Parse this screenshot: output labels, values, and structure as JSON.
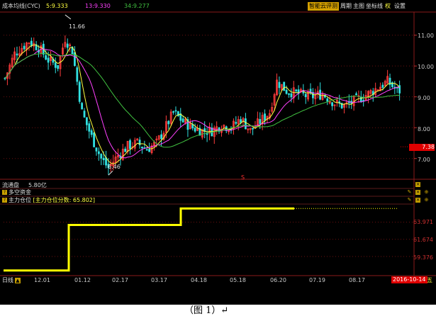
{
  "header": {
    "indicator_name": "成本均线(CYC)",
    "ma5": "5:9.333",
    "ma13": "13:9.330",
    "ma34": "34:9.277"
  },
  "toolbar": {
    "cloud_label": "智能云评测",
    "period_label": "周期",
    "main_chart_label": "主图",
    "axis_label": "坐标线",
    "rights_label": "权",
    "settings_label": "设置"
  },
  "price_axis": {
    "ticks": [
      "11.00",
      "10.00",
      "9.00",
      "8.00",
      "7.00"
    ],
    "current_price": "7.38"
  },
  "annotations": {
    "high_label": "11.66",
    "low_label": "6.46",
    "s_marker": "S"
  },
  "float_share": {
    "label": "流通盘",
    "value": "5.80亿"
  },
  "panels": {
    "dkzj_label": "多空资金",
    "zlcw_label": "主力仓位",
    "zlcw_score": "[主力仓位分数: 65.802]"
  },
  "sub_axis": {
    "ticks": [
      "63.971",
      "61.674",
      "59.376"
    ]
  },
  "time_axis": {
    "period": "日线",
    "dates": [
      "12.01",
      "01.12",
      "02.17",
      "03.17",
      "04.18",
      "05.18",
      "06.20",
      "07.19",
      "08.17"
    ],
    "current_date": "2016-10-14",
    "weekday": "五"
  },
  "caption": "（图 1）↵",
  "colors": {
    "bg": "#000000",
    "up": "#ff3c3c",
    "down": "#30e0e0",
    "ma5": "#ffff40",
    "ma13": "#ff40ff",
    "ma34": "#40c040",
    "step": "#ffff00",
    "grid": "#6a1010",
    "cloud_bg": "#d4a000"
  },
  "chart_data": [
    {
      "type": "candlestick",
      "title": "成本均线(CYC)",
      "price_ticks": [
        11.0,
        10.0,
        9.0,
        8.0,
        7.0
      ],
      "ylim": [
        6.35,
        11.75
      ],
      "x_ticks": [
        "12.01",
        "01.12",
        "02.17",
        "03.17",
        "04.18",
        "05.18",
        "06.20",
        "07.19",
        "08.17"
      ],
      "anchor_prices": [
        [
          0,
          9.6
        ],
        [
          4,
          10.4
        ],
        [
          10,
          10.8
        ],
        [
          14,
          10.6
        ],
        [
          18,
          10.2
        ],
        [
          22,
          10.0
        ],
        [
          25,
          10.9
        ],
        [
          28,
          10.5
        ],
        [
          32,
          8.5
        ],
        [
          36,
          7.7
        ],
        [
          40,
          7.0
        ],
        [
          43,
          6.7
        ],
        [
          47,
          7.1
        ],
        [
          51,
          7.4
        ],
        [
          55,
          7.5
        ],
        [
          59,
          7.3
        ],
        [
          63,
          7.5
        ],
        [
          66,
          7.9
        ],
        [
          70,
          8.5
        ],
        [
          74,
          8.2
        ],
        [
          78,
          8.0
        ],
        [
          82,
          7.9
        ],
        [
          86,
          7.9
        ],
        [
          90,
          8.1
        ],
        [
          94,
          8.0
        ],
        [
          98,
          8.3
        ],
        [
          102,
          7.9
        ],
        [
          106,
          8.2
        ],
        [
          110,
          8.5
        ],
        [
          113,
          9.5
        ],
        [
          117,
          9.2
        ],
        [
          122,
          9.1
        ],
        [
          127,
          9.0
        ],
        [
          132,
          9.1
        ],
        [
          137,
          8.8
        ],
        [
          141,
          8.7
        ],
        [
          146,
          8.9
        ],
        [
          151,
          9.1
        ],
        [
          155,
          9.3
        ],
        [
          159,
          9.5
        ],
        [
          163,
          9.2
        ]
      ],
      "high_mark": 11.66,
      "low_mark": 6.46,
      "last_price": 7.38,
      "series": [
        {
          "name": "5",
          "value": 9.333
        },
        {
          "name": "13",
          "value": 9.33
        },
        {
          "name": "34",
          "value": 9.277
        }
      ]
    },
    {
      "type": "line",
      "title": "主力仓位",
      "y_ticks": [
        63.971,
        61.674,
        59.376
      ],
      "ylim": [
        57.0,
        66.3
      ],
      "steps": [
        {
          "from": "12.01",
          "value": 57.5
        },
        {
          "from": "01.12",
          "value": 63.6
        },
        {
          "from": "03.17",
          "value": 65.8
        }
      ],
      "current": 65.802
    }
  ]
}
